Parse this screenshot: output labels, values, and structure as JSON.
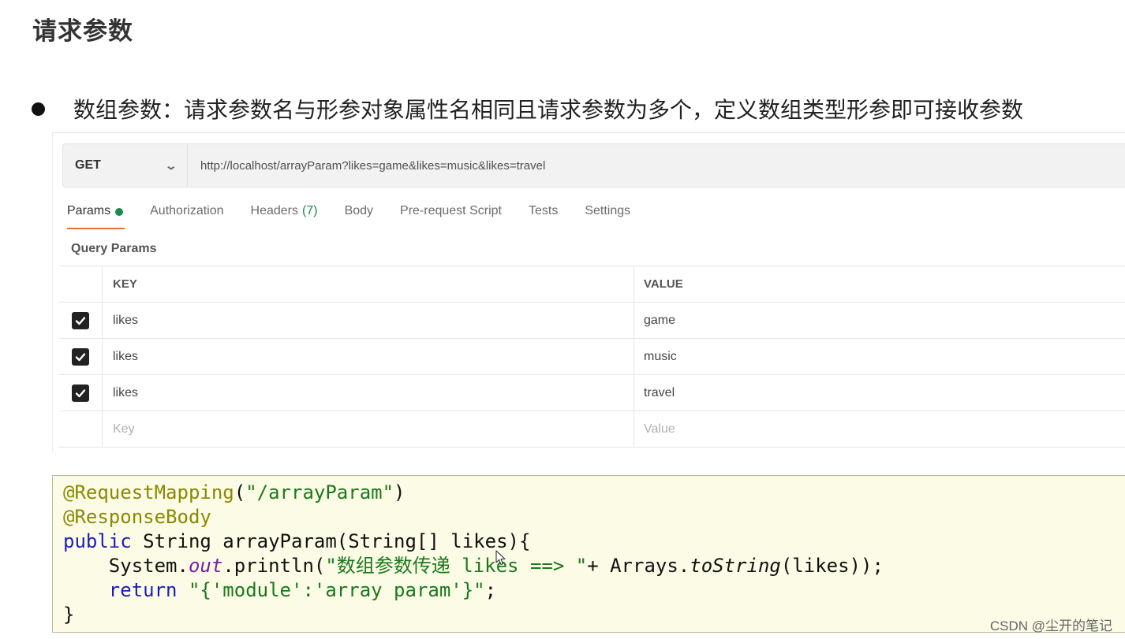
{
  "slide": {
    "title": "请求参数",
    "bullet": "数组参数：请求参数名与形参对象属性名相同且请求参数为多个，定义数组类型形参即可接收参数"
  },
  "request": {
    "method": "GET",
    "url": "http://localhost/arrayParam?likes=game&likes=music&likes=travel"
  },
  "tabs": [
    {
      "label": "Params",
      "active": true
    },
    {
      "label": "Authorization"
    },
    {
      "label": "Headers",
      "count": "(7)"
    },
    {
      "label": "Body"
    },
    {
      "label": "Pre-request Script"
    },
    {
      "label": "Tests"
    },
    {
      "label": "Settings"
    }
  ],
  "query_params": {
    "label": "Query Params",
    "header_key": "KEY",
    "header_value": "VALUE",
    "rows": [
      {
        "key": "likes",
        "value": "game",
        "checked": true
      },
      {
        "key": "likes",
        "value": "music",
        "checked": true
      },
      {
        "key": "likes",
        "value": "travel",
        "checked": true
      }
    ],
    "placeholder_key": "Key",
    "placeholder_value": "Value"
  },
  "code": {
    "l1_ann": "@RequestMapping",
    "l1_open": "(",
    "l1_str": "\"/arrayParam\"",
    "l1_close": ")",
    "l2_ann": "@ResponseBody",
    "l3_kw": "public",
    "l3_rest": " String arrayParam(String[] likes){",
    "l4_a": "    System.",
    "l4_field": "out",
    "l4_b": ".println(",
    "l4_str": "\"数组参数传递 likes ==> \"",
    "l4_c": "+ Arrays.",
    "l4_method": "toString",
    "l4_d": "(likes));",
    "l5_indent": "    ",
    "l5_kw": "return",
    "l5_sp": " ",
    "l5_str": "\"{'module':'array param'}\"",
    "l5_end": ";",
    "l6": "}"
  },
  "watermark": "CSDN @尘开的笔记",
  "colors": {
    "tab_underline": "#f26b3a",
    "status_green": "#1b8a4a",
    "code_background": "#fbfbe6"
  }
}
